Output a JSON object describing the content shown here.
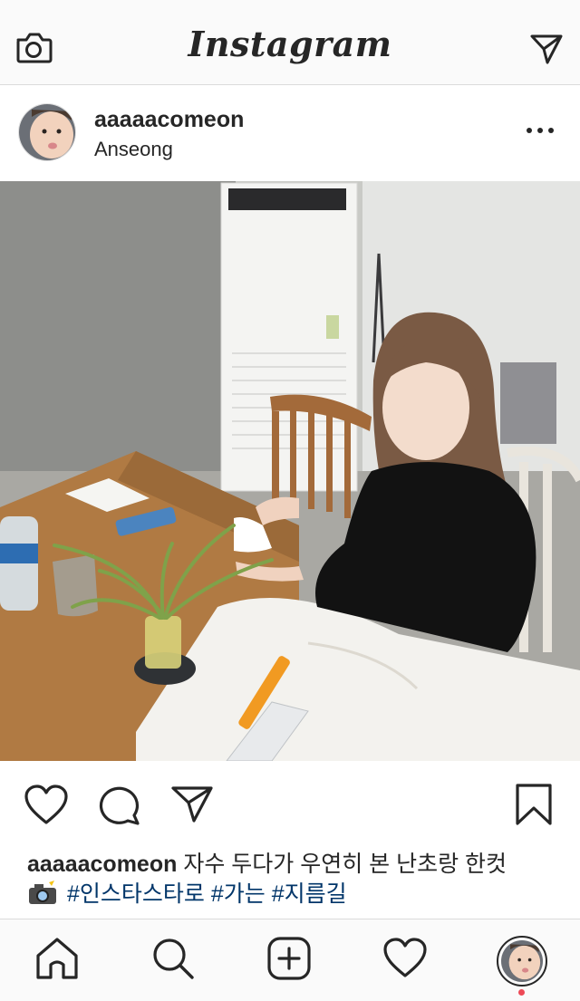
{
  "app": {
    "logo": "Instagram"
  },
  "post": {
    "username": "aaaaacomeon",
    "location": "Anseong",
    "caption": {
      "username": "aaaaacomeon",
      "text_line1": " 자수 두다가 우연히 본 난초랑 한컷",
      "tags": [
        "#인스타스타로",
        "#가는",
        "#지름길"
      ]
    }
  },
  "icons": {
    "topbar_left": "camera-icon",
    "topbar_right": "direct-message-icon",
    "more": "more-options-icon",
    "like": "heart-icon",
    "comment": "comment-icon",
    "share": "share-icon",
    "save": "bookmark-icon",
    "tabs": [
      "home-icon",
      "search-icon",
      "add-post-icon",
      "activity-heart-icon",
      "profile-avatar"
    ]
  },
  "colors": {
    "hashtag": "#003569",
    "text": "#262626",
    "notification_dot": "#ed4956",
    "divider": "#dbdbdb"
  }
}
